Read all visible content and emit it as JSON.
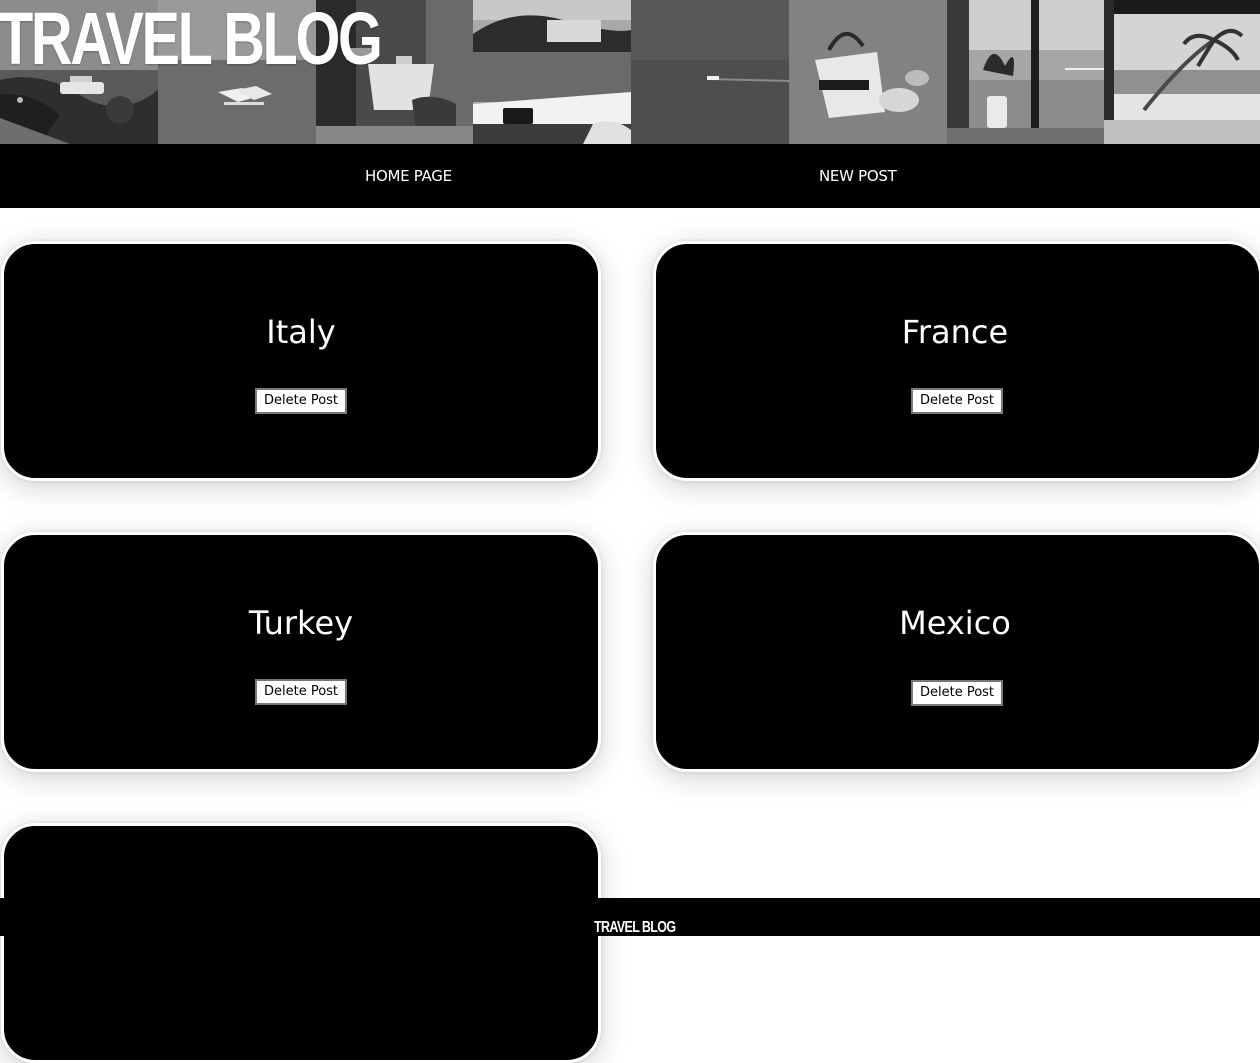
{
  "header": {
    "title": "TRAVEL BLOG",
    "photos": [
      "marina-coast-photo",
      "beach-loungers-photo",
      "cafe-table-photo",
      "lake-villa-photo",
      "sea-boat-photo",
      "beach-bag-photo",
      "balcony-sea-photo",
      "palm-beach-photo"
    ]
  },
  "nav": {
    "home_label": "HOME PAGE",
    "new_post_label": "NEW POST"
  },
  "posts": [
    {
      "title": "Italy",
      "delete_label": "Delete Post"
    },
    {
      "title": "France",
      "delete_label": "Delete Post"
    },
    {
      "title": "Turkey",
      "delete_label": "Delete Post"
    },
    {
      "title": "Mexico",
      "delete_label": "Delete Post"
    },
    {
      "title": "",
      "delete_label": ""
    }
  ],
  "footer": {
    "brand": "TRAVEL BLOG"
  },
  "colors": {
    "background": "#ffffff",
    "nav_bg": "#000000",
    "card_bg": "#000000",
    "text_light": "#ffffff"
  }
}
